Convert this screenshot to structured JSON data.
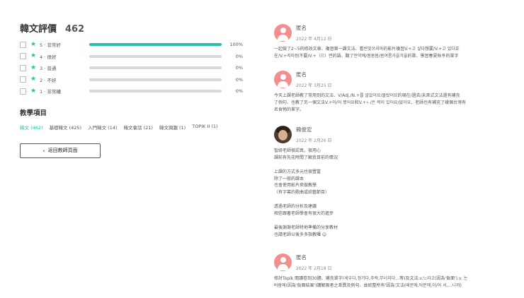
{
  "summary": {
    "title": "韓文評價",
    "count": "462"
  },
  "ratings": [
    {
      "label": "5 · 非常好",
      "pct": "100%",
      "fill": 1.0
    },
    {
      "label": "4 · 很好",
      "pct": "0%",
      "fill": 0
    },
    {
      "label": "3 · 普通",
      "pct": "0%",
      "fill": 0
    },
    {
      "label": "2 · 不好",
      "pct": "0%",
      "fill": 0
    },
    {
      "label": "1 · 非常糟",
      "pct": "0%",
      "fill": 0
    }
  ],
  "subjects": {
    "title": "教學項目",
    "tabs": [
      "韓文 (462)",
      "基礎韓文 (425)",
      "入門韓文 (14)",
      "韓文會話 (21)",
      "韓文興趣 (1)",
      "TOPIK II (1)"
    ]
  },
  "back_button": {
    "label": "返回教師頁面"
  },
  "reviews": [
    {
      "name": "匿名",
      "date": "2022 年 4月12 日",
      "text": "一起做了2~5的修改文章、複習第一課文法、看뱐맞쓰지마的影片複習V.+고 싶다想要/V.+고 있다正\n在/V.+지마別不要/V.+（으）면的語、聽了안약예/봄봄봄/봄여름가을겨울的歌、學習春夏秋冬的單字"
    },
    {
      "name": "匿名",
      "date": "2022 年 3月25 日",
      "text": "今天上課老師教了常用到的文法、V/Adj./N.+를 알았어요/몰랐어요的現在/過去/未來式文法還有補充\n了例句、也教了另一個文法V.+아/어 봤어요和V.+ㄴ/은 적이 있어요/없어요、老師也有補充了幾個台灣有\n名食物的單字。"
    },
    {
      "name": "賴俊宏",
      "date": "2022 年 2月26 日",
      "text": "智妍老師很認真，很用心\n課前有先花時間了解我目前的情況\n\n上課的方式多元也很豐富\n除了一般的課本\n也會使用影片來做教學\n（有字幕的歌曲或綜藝節目）\n\n透過老師的分析及建議\n相信跟著老師學會有很大的進步\n\n最後謝謝老師特地準備的分享教材\n也請老師以後多多指教囉 ☺"
    },
    {
      "name": "匿名",
      "date": "2022 年 2月18 日",
      "text": "修討Topik 閱讀卷到30題、補充單字(세우다,정기다,추락,무너지다…等)及文法:v.느라고(因為'負面'),v. 는\n바람에(因為'負面結果')講解兩者之差異及例句、並統整所有'因為'文法(때문에,덕분에,아/어 서,…니까)"
    }
  ]
}
